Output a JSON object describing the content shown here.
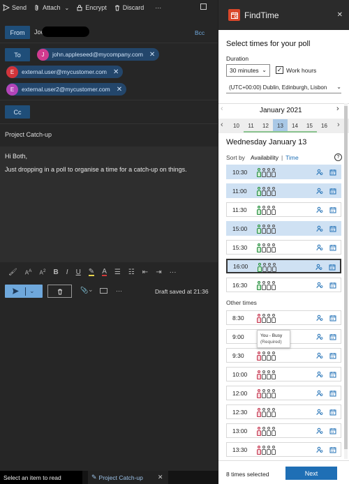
{
  "toolbar": {
    "send": "Send",
    "attach": "Attach",
    "encrypt": "Encrypt",
    "discard": "Discard",
    "more": "···"
  },
  "from": {
    "label": "From",
    "name": "Joe"
  },
  "bcc": "Bcc",
  "to": {
    "label": "To",
    "recipients": [
      {
        "initial": "J",
        "email": "john.appleseed@mycompany.com",
        "color": "#d13b8f"
      },
      {
        "initial": "E",
        "email": "external.user@mycustomer.com",
        "color": "#d1343b"
      },
      {
        "initial": "E",
        "email": "external.user2@mycustomer.com",
        "color": "#b344b8"
      }
    ]
  },
  "cc": {
    "label": "Cc"
  },
  "subject": "Project Catch-up",
  "body": {
    "greeting": "Hi Both,",
    "line": "Just dropping in a poll to organise a time for a catch-up on things."
  },
  "draft_status": "Draft saved at 21:36",
  "bottom": {
    "status": "Select an item to read",
    "tab": "Project Catch-up"
  },
  "findtime": {
    "title": "FindTime",
    "heading": "Select times for your poll",
    "duration_label": "Duration",
    "duration_value": "30 minutes",
    "work_hours": "Work hours",
    "timezone": "(UTC+00:00) Dublin, Edinburgh, Lisbon",
    "month": "January 2021",
    "days": [
      "10",
      "11",
      "12",
      "13",
      "14",
      "15",
      "16"
    ],
    "selected_day": "13",
    "date_heading": "Wednesday January 13",
    "sort_by": "Sort by",
    "sort_availability": "Availability",
    "sort_sep": "|",
    "sort_time": "Time",
    "help": "?",
    "slots": [
      {
        "time": "10:30",
        "selected": true,
        "people": [
          "g",
          "n",
          "n",
          "n"
        ]
      },
      {
        "time": "11:00",
        "selected": true,
        "people": [
          "g",
          "n",
          "n",
          "n"
        ]
      },
      {
        "time": "11:30",
        "selected": false,
        "people": [
          "g",
          "n",
          "n",
          "n"
        ]
      },
      {
        "time": "15:00",
        "selected": true,
        "people": [
          "g",
          "n",
          "n",
          "n"
        ]
      },
      {
        "time": "15:30",
        "selected": false,
        "people": [
          "g",
          "n",
          "n",
          "n"
        ]
      },
      {
        "time": "16:00",
        "selected": true,
        "people": [
          "g",
          "n",
          "n",
          "n"
        ]
      },
      {
        "time": "16:30",
        "selected": false,
        "people": [
          "g",
          "n",
          "n",
          "n"
        ]
      }
    ],
    "other_times_label": "Other times",
    "other_slots": [
      {
        "time": "8:30",
        "people": [
          "r",
          "n",
          "n",
          "n"
        ]
      },
      {
        "time": "9:00",
        "people": [
          "r",
          "n",
          "n",
          "n"
        ]
      },
      {
        "time": "9:30",
        "people": [
          "r",
          "n",
          "n",
          "n"
        ]
      },
      {
        "time": "10:00",
        "people": [
          "r",
          "n",
          "n",
          "n"
        ]
      },
      {
        "time": "12:00",
        "people": [
          "r",
          "n",
          "n",
          "n"
        ]
      },
      {
        "time": "12:30",
        "people": [
          "r",
          "n",
          "n",
          "n"
        ]
      },
      {
        "time": "13:00",
        "people": [
          "r",
          "n",
          "n",
          "n"
        ]
      },
      {
        "time": "13:30",
        "people": [
          "r",
          "n",
          "n",
          "n"
        ]
      }
    ],
    "tooltip": {
      "line1": "You - Busy",
      "line2": "(Required)"
    },
    "selected_count": "8 times selected",
    "next": "Next"
  }
}
